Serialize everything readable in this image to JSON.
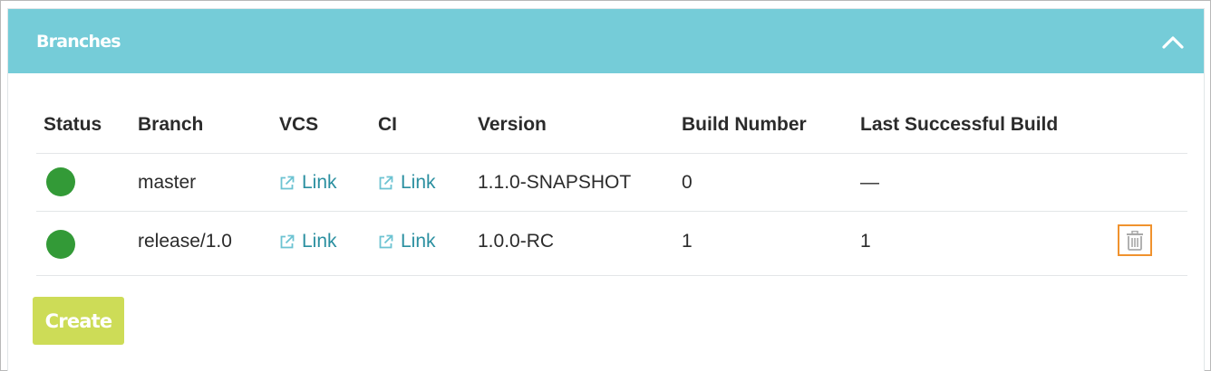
{
  "panel": {
    "title": "Branches",
    "collapse_icon": "chevron-up-icon"
  },
  "table": {
    "columns": [
      "Status",
      "Branch",
      "VCS",
      "CI",
      "Version",
      "Build Number",
      "Last Successful Build"
    ],
    "rows": [
      {
        "status": "success",
        "status_color": "#339a37",
        "branch": "master",
        "vcs": "Link",
        "ci": "Link",
        "version": "1.1.0-SNAPSHOT",
        "build_number": "0",
        "last_successful_build": "—",
        "deletable": false
      },
      {
        "status": "success",
        "status_color": "#339a37",
        "branch": "release/1.0",
        "vcs": "Link",
        "ci": "Link",
        "version": "1.0.0-RC",
        "build_number": "1",
        "last_successful_build": "1",
        "deletable": true,
        "delete_icon": "trash-icon"
      }
    ]
  },
  "actions": {
    "create_label": "Create"
  },
  "colors": {
    "header_bg": "#75ccd8",
    "link": "#2a8fa0",
    "status_ok": "#339a37",
    "create_bg": "#cddc57",
    "focus_border": "#f0922e"
  }
}
